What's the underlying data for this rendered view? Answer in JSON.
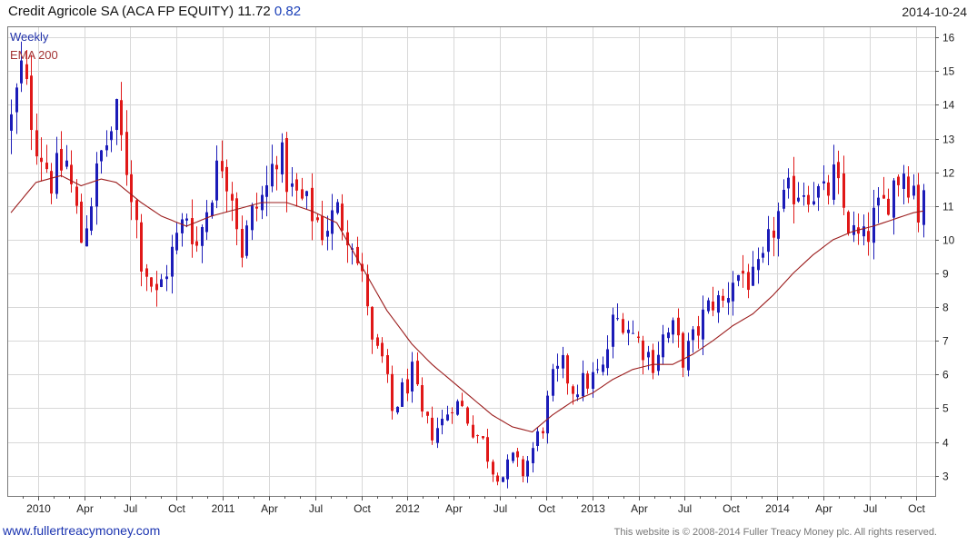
{
  "header": {
    "security": "Credit Agricole SA (ACA FP EQUITY)",
    "last_price": "11.72",
    "change": "0.82",
    "date": "2014-10-24"
  },
  "footer": {
    "url": "www.fullertreacymoney.com",
    "copyright": "This website is © 2008-2014 Fuller Treacy Money plc. All rights reserved."
  },
  "colors": {
    "up": "#1c1cb8",
    "down": "#e01818",
    "ema": "#9b1c1c",
    "legend_weekly": "#2233aa",
    "legend_ema": "#a33333",
    "grid": "#d8d8d8"
  },
  "chart_data": {
    "type": "candlestick",
    "frequency_label": "Weekly",
    "ema_label": "EMA 200",
    "ylim": [
      2.4,
      16.3
    ],
    "yticks": [
      3,
      4,
      5,
      6,
      7,
      8,
      9,
      10,
      11,
      12,
      13,
      14,
      15,
      16
    ],
    "x_start": "2009-11",
    "x_end": "2014-10",
    "xtick_labels": [
      "2010",
      "Apr",
      "Jul",
      "Oct",
      "2011",
      "Apr",
      "Jul",
      "Oct",
      "2012",
      "Apr",
      "Jul",
      "Oct",
      "2013",
      "Apr",
      "Jul",
      "Oct",
      "2014",
      "Apr",
      "Jul",
      "Oct"
    ],
    "close_path": [
      [
        0,
        13.5
      ],
      [
        2,
        15.0
      ],
      [
        5,
        13.0
      ],
      [
        8,
        11.8
      ],
      [
        11,
        12.3
      ],
      [
        14,
        10.0
      ],
      [
        18,
        12.5
      ],
      [
        21,
        13.6
      ],
      [
        24,
        11.5
      ],
      [
        26,
        9.5
      ],
      [
        29,
        8.3
      ],
      [
        32,
        9.6
      ],
      [
        35,
        10.8
      ],
      [
        37,
        9.8
      ],
      [
        40,
        11.6
      ],
      [
        42,
        12.4
      ],
      [
        44,
        11.5
      ],
      [
        46,
        9.7
      ],
      [
        48,
        10.7
      ],
      [
        51,
        11.5
      ],
      [
        53,
        12.7
      ],
      [
        56,
        11.4
      ],
      [
        60,
        10.8
      ],
      [
        62,
        10.3
      ],
      [
        65,
        10.8
      ],
      [
        68,
        10.1
      ],
      [
        69,
        9.3
      ],
      [
        71,
        8.2
      ],
      [
        72,
        6.8
      ],
      [
        74,
        6.4
      ],
      [
        76,
        4.9
      ],
      [
        78,
        5.5
      ],
      [
        80,
        6.0
      ],
      [
        82,
        4.7
      ],
      [
        84,
        4.3
      ],
      [
        86,
        4.6
      ],
      [
        88,
        5.2
      ],
      [
        90,
        5.0
      ],
      [
        92,
        4.4
      ],
      [
        94,
        4.0
      ],
      [
        96,
        3.2
      ],
      [
        98,
        3.0
      ],
      [
        100,
        3.5
      ],
      [
        102,
        3.1
      ],
      [
        104,
        3.8
      ],
      [
        106,
        4.5
      ],
      [
        108,
        5.8
      ],
      [
        110,
        6.2
      ],
      [
        112,
        5.6
      ],
      [
        115,
        5.8
      ],
      [
        118,
        6.1
      ],
      [
        120,
        7.5
      ],
      [
        122,
        7.7
      ],
      [
        124,
        7.2
      ],
      [
        126,
        6.8
      ],
      [
        128,
        6.4
      ],
      [
        130,
        7.1
      ],
      [
        132,
        7.3
      ],
      [
        134,
        6.5
      ],
      [
        136,
        7.0
      ],
      [
        138,
        7.7
      ],
      [
        140,
        8.2
      ],
      [
        142,
        8.1
      ],
      [
        144,
        8.9
      ],
      [
        146,
        9.0
      ],
      [
        148,
        8.7
      ],
      [
        150,
        9.2
      ],
      [
        152,
        10.4
      ],
      [
        154,
        11.0
      ],
      [
        156,
        11.5
      ],
      [
        158,
        11.6
      ],
      [
        160,
        11.5
      ],
      [
        162,
        11.2
      ],
      [
        164,
        11.8
      ],
      [
        166,
        10.9
      ],
      [
        168,
        10.1
      ],
      [
        170,
        9.9
      ],
      [
        172,
        10.6
      ],
      [
        174,
        11.0
      ],
      [
        176,
        11.7
      ],
      [
        178,
        12.1
      ],
      [
        180,
        11.6
      ],
      [
        181,
        10.8
      ],
      [
        182,
        11.7
      ]
    ],
    "ema_path": [
      [
        0,
        10.8
      ],
      [
        5,
        11.7
      ],
      [
        10,
        11.9
      ],
      [
        14,
        11.6
      ],
      [
        18,
        11.8
      ],
      [
        21,
        11.7
      ],
      [
        26,
        11.1
      ],
      [
        30,
        10.7
      ],
      [
        35,
        10.4
      ],
      [
        40,
        10.7
      ],
      [
        45,
        10.9
      ],
      [
        50,
        11.1
      ],
      [
        55,
        11.1
      ],
      [
        60,
        10.85
      ],
      [
        65,
        10.5
      ],
      [
        70,
        9.2
      ],
      [
        75,
        7.9
      ],
      [
        80,
        6.9
      ],
      [
        84,
        6.3
      ],
      [
        88,
        5.8
      ],
      [
        92,
        5.3
      ],
      [
        96,
        4.8
      ],
      [
        100,
        4.45
      ],
      [
        104,
        4.3
      ],
      [
        108,
        4.8
      ],
      [
        112,
        5.2
      ],
      [
        116,
        5.45
      ],
      [
        120,
        5.85
      ],
      [
        124,
        6.15
      ],
      [
        128,
        6.3
      ],
      [
        132,
        6.3
      ],
      [
        136,
        6.6
      ],
      [
        140,
        7.0
      ],
      [
        144,
        7.45
      ],
      [
        148,
        7.8
      ],
      [
        152,
        8.35
      ],
      [
        156,
        9.0
      ],
      [
        160,
        9.55
      ],
      [
        164,
        10.0
      ],
      [
        168,
        10.25
      ],
      [
        172,
        10.4
      ],
      [
        176,
        10.6
      ],
      [
        180,
        10.8
      ],
      [
        182,
        10.85
      ]
    ]
  }
}
